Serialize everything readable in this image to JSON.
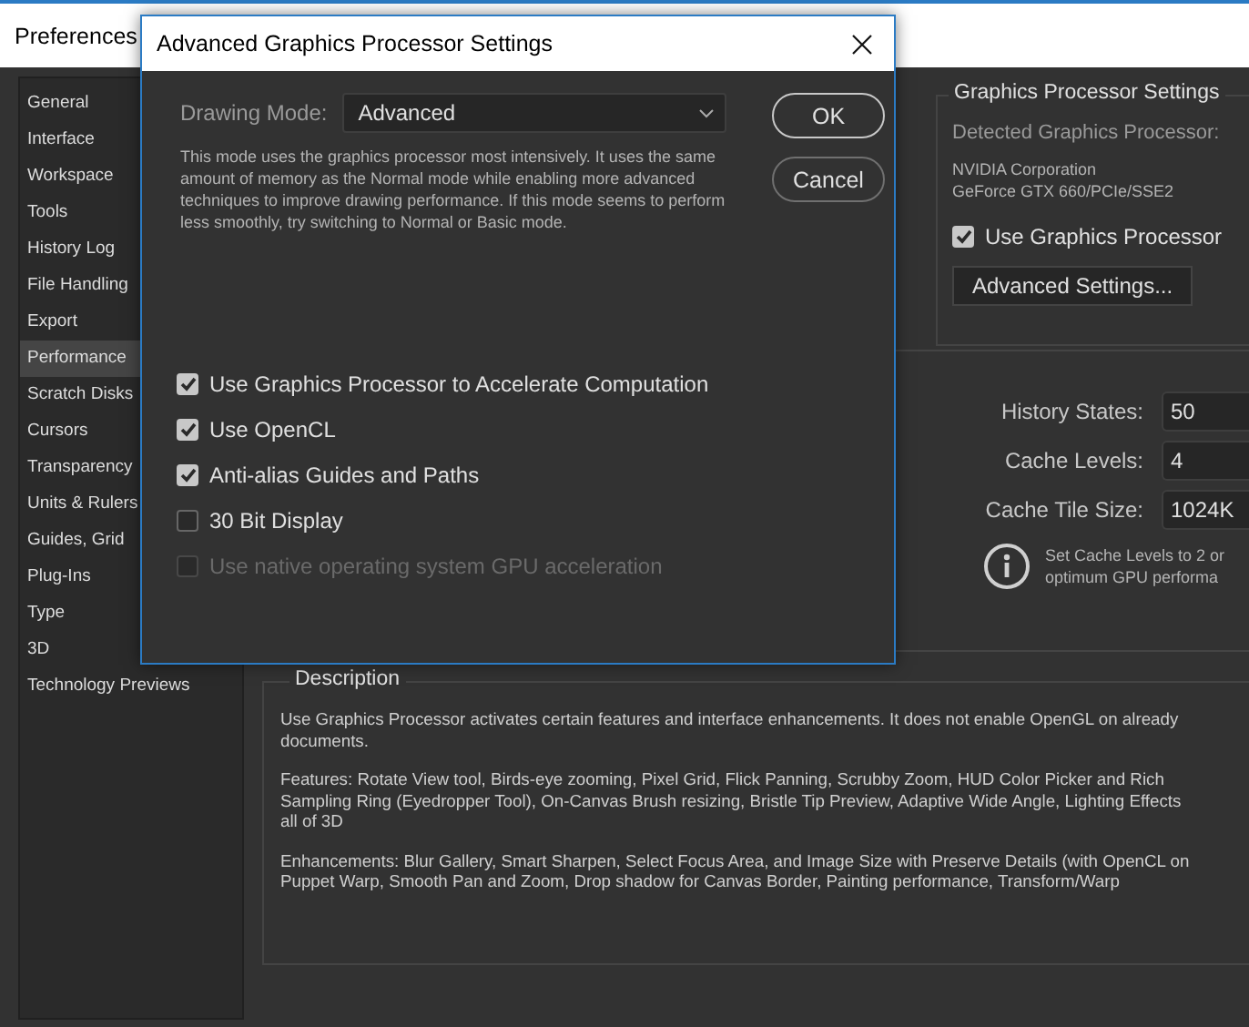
{
  "window": {
    "title": "Preferences"
  },
  "sidebar": {
    "items": [
      {
        "label": "General",
        "selected": false
      },
      {
        "label": "Interface",
        "selected": false
      },
      {
        "label": "Workspace",
        "selected": false
      },
      {
        "label": "Tools",
        "selected": false
      },
      {
        "label": "History Log",
        "selected": false
      },
      {
        "label": "File Handling",
        "selected": false
      },
      {
        "label": "Export",
        "selected": false
      },
      {
        "label": "Performance",
        "selected": true
      },
      {
        "label": "Scratch Disks",
        "selected": false
      },
      {
        "label": "Cursors",
        "selected": false
      },
      {
        "label": "Transparency",
        "selected": false
      },
      {
        "label": "Units & Rulers",
        "selected": false
      },
      {
        "label": "Guides, Grid",
        "selected": false
      },
      {
        "label": "Plug-Ins",
        "selected": false
      },
      {
        "label": "Type",
        "selected": false
      },
      {
        "label": "3D",
        "selected": false
      },
      {
        "label": "Technology Previews",
        "selected": false
      }
    ]
  },
  "gpu_settings": {
    "title": "Graphics Processor Settings",
    "detected_label": "Detected Graphics Processor:",
    "gpu_lines": [
      "NVIDIA Corporation",
      "GeForce GTX 660/PCIe/SSE2"
    ],
    "use_gpu": {
      "label": "Use Graphics Processor",
      "checked": true
    },
    "advanced_button": "Advanced Settings..."
  },
  "history": {
    "fields": [
      {
        "label": "History States:",
        "value": "50"
      },
      {
        "label": "Cache Levels:",
        "value": "4"
      },
      {
        "label": "Cache Tile Size:",
        "value": "1024K"
      }
    ],
    "info_lines": [
      "Set Cache Levels to 2 or",
      "optimum GPU performa"
    ]
  },
  "description": {
    "title": "Description",
    "paragraphs": [
      [
        "Use Graphics Processor activates certain features and interface enhancements. It does not enable OpenGL on already",
        "documents."
      ],
      [
        "Features: Rotate View tool, Birds-eye zooming, Pixel Grid, Flick Panning, Scrubby Zoom, HUD Color Picker and Rich",
        "Sampling Ring (Eyedropper Tool), On-Canvas Brush resizing, Bristle Tip Preview, Adaptive Wide Angle, Lighting Effects",
        "all of 3D"
      ],
      [
        "Enhancements: Blur Gallery, Smart Sharpen, Select Focus Area, and Image Size with Preserve Details (with OpenCL on",
        "Puppet Warp, Smooth Pan and Zoom, Drop shadow for Canvas Border, Painting performance, Transform/Warp"
      ]
    ]
  },
  "dialog": {
    "title": "Advanced Graphics Processor Settings",
    "drawing_mode": {
      "label": "Drawing Mode:",
      "value": "Advanced"
    },
    "mode_text": "This mode uses the graphics processor most intensively.  It uses the same amount of memory as the Normal mode while enabling more advanced techniques to improve drawing performance.  If this mode seems to perform less smoothly, try switching to Normal or Basic mode.",
    "options": [
      {
        "label": "Use Graphics Processor to Accelerate Computation",
        "checked": true,
        "disabled": false
      },
      {
        "label": "Use OpenCL",
        "checked": true,
        "disabled": false
      },
      {
        "label": "Anti-alias Guides and Paths",
        "checked": true,
        "disabled": false
      },
      {
        "label": "30 Bit Display",
        "checked": false,
        "disabled": false
      },
      {
        "label": "Use native operating system GPU acceleration",
        "checked": false,
        "disabled": true
      }
    ],
    "buttons": [
      {
        "label": "OK",
        "default": true
      },
      {
        "label": "Cancel",
        "default": false
      }
    ]
  }
}
